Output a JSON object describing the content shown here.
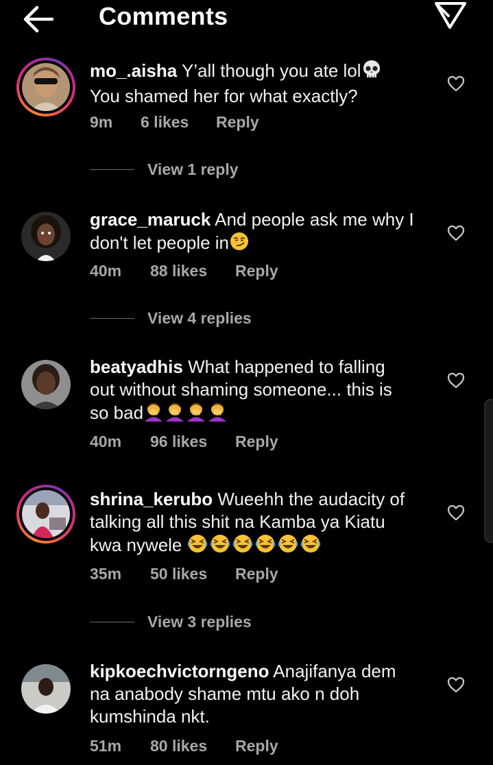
{
  "header": {
    "title": "Comments",
    "back_icon": "arrow-left-icon",
    "send_icon": "direct-send-icon"
  },
  "colors": {
    "background": "#000000",
    "text": "#ffffff",
    "muted": "#a8a8a8",
    "story_ring": [
      "#f58529",
      "#dd2a7b",
      "#8134af"
    ]
  },
  "comments": [
    {
      "username": "mo_.aisha",
      "text": "Y’all  though you ate lol",
      "text2": "You shamed her for what exactly?",
      "emoji": "skull",
      "time": "9m",
      "likes": "6 likes",
      "reply": "Reply",
      "view_replies": "View 1 reply"
    },
    {
      "username": "grace_maruck",
      "text": "And people ask me why I",
      "text2": "don't let people in",
      "emoji": "smirking-face",
      "time": "40m",
      "likes": "88 likes",
      "reply": "Reply",
      "view_replies": "View 4 replies"
    },
    {
      "username": "beatyadhis",
      "text": "What happened to falling",
      "text2": "out without shaming someone... this is",
      "text3": "so bad",
      "emoji": "woman-facepalming x4",
      "time": "40m",
      "likes": "96 likes",
      "reply": "Reply"
    },
    {
      "username": "shrina_kerubo",
      "text": "Wueehh the audacity of",
      "text2": "talking all this shit na Kamba ya Kiatu",
      "text3": "kwa nywele",
      "emoji": "rolling-on-floor-laughing x6",
      "time": "35m",
      "likes": "50 likes",
      "reply": "Reply",
      "view_replies": "View 3 replies"
    },
    {
      "username": "kipkoechvictorngeno",
      "text": "Anajifanya dem",
      "text2": "na anabody shame mtu ako n doh",
      "text3": "kumshinda nkt.",
      "time": "51m",
      "likes": "80 likes",
      "reply": "Reply"
    }
  ]
}
